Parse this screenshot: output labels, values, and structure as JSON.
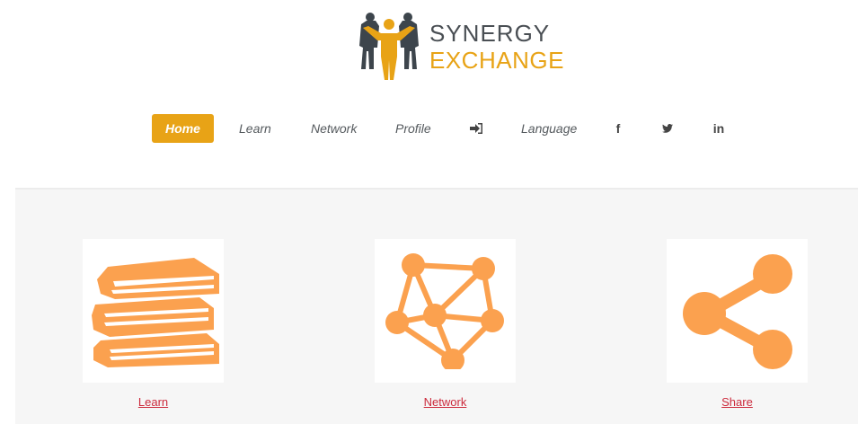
{
  "logo": {
    "line1": "SYNERGY",
    "line2": "EXCHANGE"
  },
  "nav": {
    "home": "Home",
    "learn": "Learn",
    "network": "Network",
    "profile": "Profile",
    "language": "Language",
    "icons": {
      "login": "sign-in-icon",
      "facebook": "facebook-icon",
      "twitter": "twitter-icon",
      "linkedin": "linkedin-icon"
    },
    "facebook_glyph": "f",
    "linkedin_glyph": "in"
  },
  "cards": {
    "learn": {
      "label": "Learn",
      "icon": "books-icon"
    },
    "network": {
      "label": "Network",
      "icon": "network-graph-icon"
    },
    "share": {
      "label": "Share",
      "icon": "share-icon"
    }
  },
  "colors": {
    "brand_orange": "#e8a316",
    "icon_orange": "#fba14f",
    "link_red": "#cc2a3c",
    "text_gray": "#555a5e"
  }
}
